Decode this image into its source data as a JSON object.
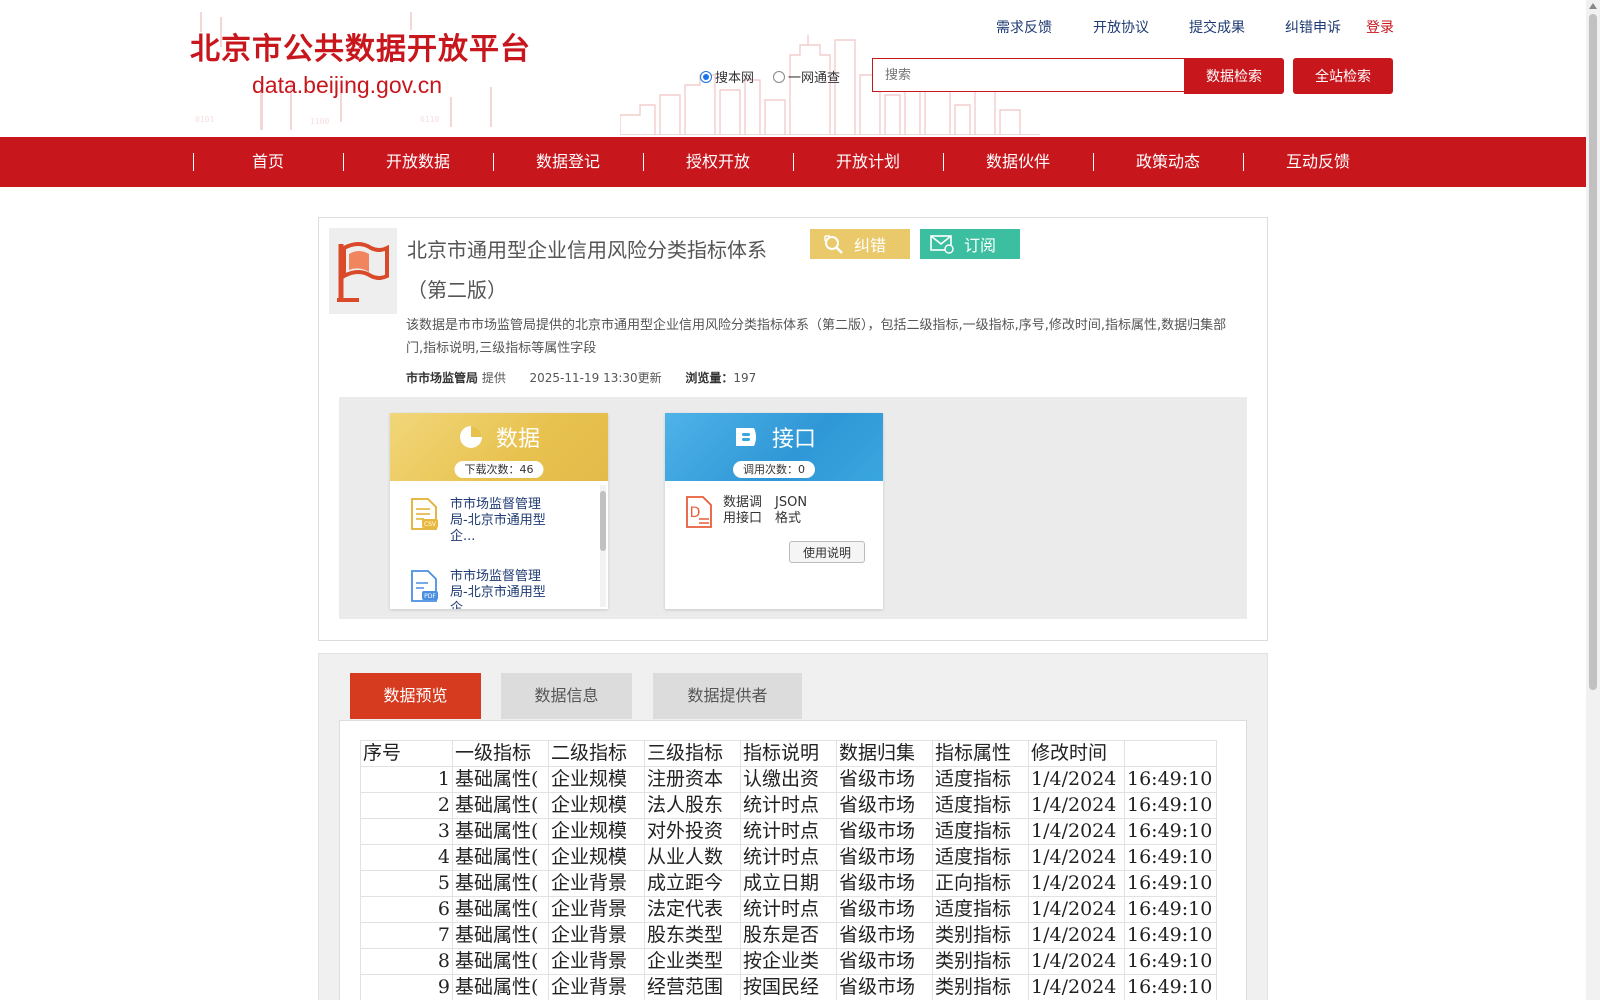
{
  "header": {
    "site_title": "北京市公共数据开放平台",
    "site_domain": "data.beijing.gov.cn",
    "top_links": [
      "需求反馈",
      "开放协议",
      "提交成果",
      "纠错申诉"
    ],
    "login": "登录",
    "search": {
      "radio_site": "搜本网",
      "radio_all": "一网通查",
      "placeholder": "搜索",
      "data_search": "数据检索",
      "site_search": "全站检索"
    }
  },
  "nav": [
    "首页",
    "开放数据",
    "数据登记",
    "授权开放",
    "开放计划",
    "数据伙伴",
    "政策动态",
    "互动反馈"
  ],
  "dataset": {
    "title": "北京市通用型企业信用风险分类指标体系（第二版）",
    "btn_correct": "纠错",
    "btn_subscribe": "订阅",
    "description": "该数据是市市场监管局提供的北京市通用型企业信用风险分类指标体系（第二版），包括二级指标,一级指标,序号,修改时间,指标属性,数据归集部门,指标说明,三级指标等属性字段",
    "provider": "市市场监管局",
    "provider_suffix": "提供",
    "updated": "2025-11-19 13:30更新",
    "views_label": "浏览量：",
    "views": "197"
  },
  "resources": {
    "data": {
      "title": "数据",
      "count_label": "下载次数：46",
      "files": [
        {
          "name": "市市场监督管理局-北京市通用型企...",
          "type": "CSV"
        },
        {
          "name": "市市场监督管理局-北京市通用型企...",
          "type": "PDF"
        }
      ]
    },
    "api": {
      "title": "接口",
      "count_label": "调用次数：0",
      "name": "数据调用接口",
      "format": "JSON格式",
      "usage_button": "使用说明"
    }
  },
  "tabs": [
    "数据预览",
    "数据信息",
    "数据提供者"
  ],
  "preview_table": {
    "headers": [
      "序号",
      "一级指标",
      "二级指标",
      "三级指标",
      "指标说明",
      "数据归集",
      "指标属性",
      "修改时间",
      ""
    ],
    "rows": [
      [
        "1",
        "基础属性(",
        "企业规模",
        "注册资本",
        "认缴出资",
        "省级市场",
        "适度指标",
        "1/4/2024",
        "16:49:10"
      ],
      [
        "2",
        "基础属性(",
        "企业规模",
        "法人股东",
        "统计时点",
        "省级市场",
        "适度指标",
        "1/4/2024",
        "16:49:10"
      ],
      [
        "3",
        "基础属性(",
        "企业规模",
        "对外投资",
        "统计时点",
        "省级市场",
        "适度指标",
        "1/4/2024",
        "16:49:10"
      ],
      [
        "4",
        "基础属性(",
        "企业规模",
        "从业人数",
        "统计时点",
        "省级市场",
        "适度指标",
        "1/4/2024",
        "16:49:10"
      ],
      [
        "5",
        "基础属性(",
        "企业背景",
        "成立距今",
        "成立日期",
        "省级市场",
        "正向指标",
        "1/4/2024",
        "16:49:10"
      ],
      [
        "6",
        "基础属性(",
        "企业背景",
        "法定代表",
        "统计时点",
        "省级市场",
        "适度指标",
        "1/4/2024",
        "16:49:10"
      ],
      [
        "7",
        "基础属性(",
        "企业背景",
        "股东类型",
        "股东是否",
        "省级市场",
        "类别指标",
        "1/4/2024",
        "16:49:10"
      ],
      [
        "8",
        "基础属性(",
        "企业背景",
        "企业类型",
        "按企业类",
        "省级市场",
        "类别指标",
        "1/4/2024",
        "16:49:10"
      ],
      [
        "9",
        "基础属性(",
        "企业背景",
        "经营范围",
        "按国民经",
        "省级市场",
        "类别指标",
        "1/4/2024",
        "16:49:10"
      ]
    ]
  },
  "colors": {
    "brand_red": "#c8161d",
    "tab_active": "#d63b1f",
    "correct_yellow": "#e9c96a",
    "subscribe_green": "#3cbfa0"
  }
}
